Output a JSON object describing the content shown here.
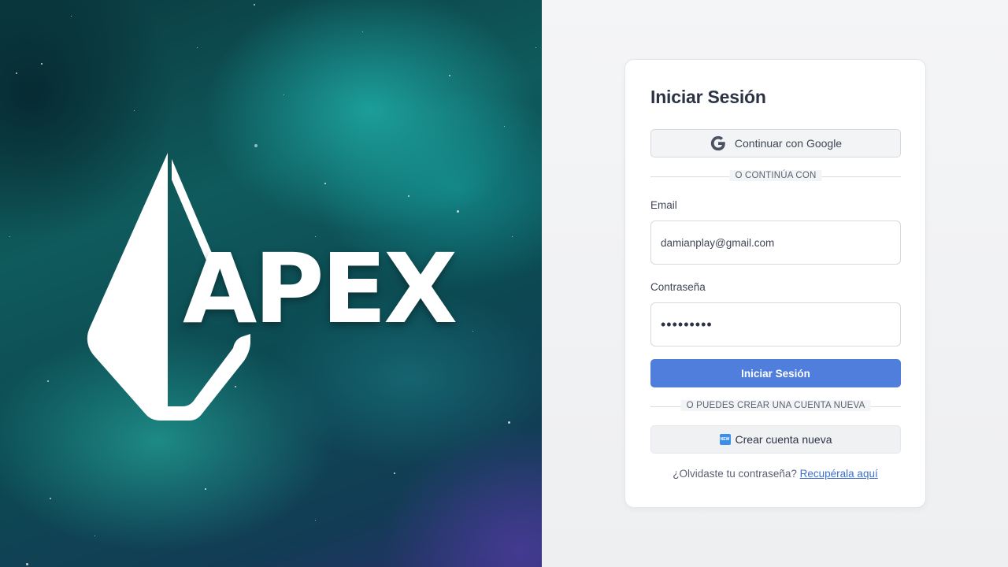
{
  "brand": {
    "name": "APEX",
    "logo_icon": "apex-gem-logo"
  },
  "login": {
    "title": "Iniciar Sesión",
    "google_button_label": "Continuar con Google",
    "google_icon": "google-g-icon",
    "divider_continue": "O CONTINÚA CON",
    "email_label": "Email",
    "email_value": "damianplay@gmail.com",
    "password_label": "Contraseña",
    "password_value": "•••••••••",
    "submit_label": "Iniciar Sesión",
    "divider_create": "O PUEDES CREAR UNA CUENTA NUEVA",
    "create_badge": "NEW",
    "create_label": "Crear cuenta nueva",
    "forgot_text": "¿Olvidaste tu contraseña?",
    "forgot_link": "Recupérala aquí"
  },
  "colors": {
    "accent": "#4f7edc",
    "link": "#3f6fcf",
    "text_dark": "#2c3345",
    "hero_teal": "#0f5a5c"
  }
}
